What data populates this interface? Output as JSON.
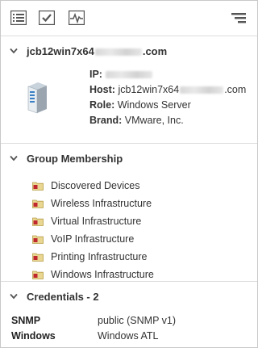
{
  "toolbar": {
    "buttons": [
      "list-details-icon",
      "checklist-icon",
      "performance-chart-icon",
      "menu-icon"
    ]
  },
  "device": {
    "name_prefix": "jcb12win7x64",
    "name_suffix": ".com",
    "ip_label": "IP:",
    "host_label": "Host:",
    "host_prefix": "jcb12win7x64",
    "host_suffix": ".com",
    "role_label": "Role:",
    "role_value": "Windows Server",
    "brand_label": "Brand:",
    "brand_value": "VMware, Inc."
  },
  "groups": {
    "title": "Group Membership",
    "items": [
      "Discovered Devices",
      "Wireless Infrastructure",
      "Virtual Infrastructure",
      "VoIP Infrastructure",
      "Printing Infrastructure",
      "Windows Infrastructure"
    ]
  },
  "credentials": {
    "title": "Credentials - 2",
    "rows": [
      {
        "key": "SNMP",
        "value": "public (SNMP v1)"
      },
      {
        "key": "Windows",
        "value": "Windows ATL"
      }
    ]
  },
  "colors": {
    "folder": "#e9d690",
    "folder_badge": "#c0262d",
    "icon_gray": "#555555"
  }
}
